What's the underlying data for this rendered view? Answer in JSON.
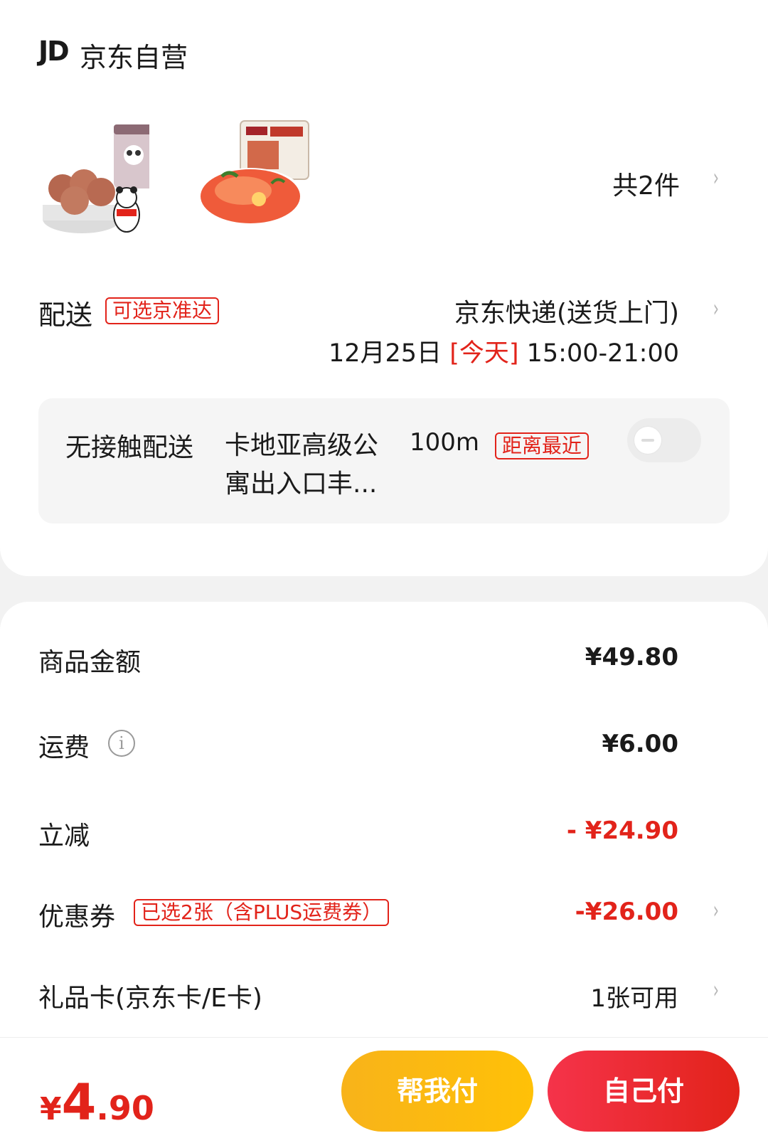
{
  "store": {
    "logo": "JD",
    "name": "京东自营"
  },
  "products": {
    "items": [
      {
        "icon": "panda-cookie-jar-product-image"
      },
      {
        "icon": "noodle-dish-product-image"
      }
    ],
    "count_label": "共2件"
  },
  "delivery": {
    "label": "配送",
    "tag": "可选京准达",
    "method": "京东快递(送货上门)",
    "date": "12月25日",
    "day": "[今天]",
    "time": "15:00-21:00"
  },
  "contactless": {
    "title": "无接触配送",
    "address": "卡地亚高级公寓出入口丰...",
    "distance": "100m",
    "tag": "距离最近",
    "enabled": false
  },
  "summary": {
    "subtotal": {
      "label": "商品金额",
      "value": "¥49.80"
    },
    "shipping": {
      "label": "运费",
      "value": "¥6.00",
      "icon": "info-icon"
    },
    "discount": {
      "label": "立减",
      "value": "- ¥24.90"
    },
    "coupon": {
      "label": "优惠券",
      "tag": "已选2张（含PLUS运费券）",
      "value": "-¥26.00"
    },
    "giftcard": {
      "label": "礼品卡(京东卡/E卡)",
      "value": "1张可用"
    }
  },
  "bottom": {
    "currency": "¥",
    "total_int": "4",
    "total_dec": ".90",
    "help_pay": "帮我付",
    "self_pay": "自己付"
  },
  "colors": {
    "accent_red": "#e2231a",
    "accent_yellow": "#ffc107",
    "background": "#f2f2f2"
  }
}
